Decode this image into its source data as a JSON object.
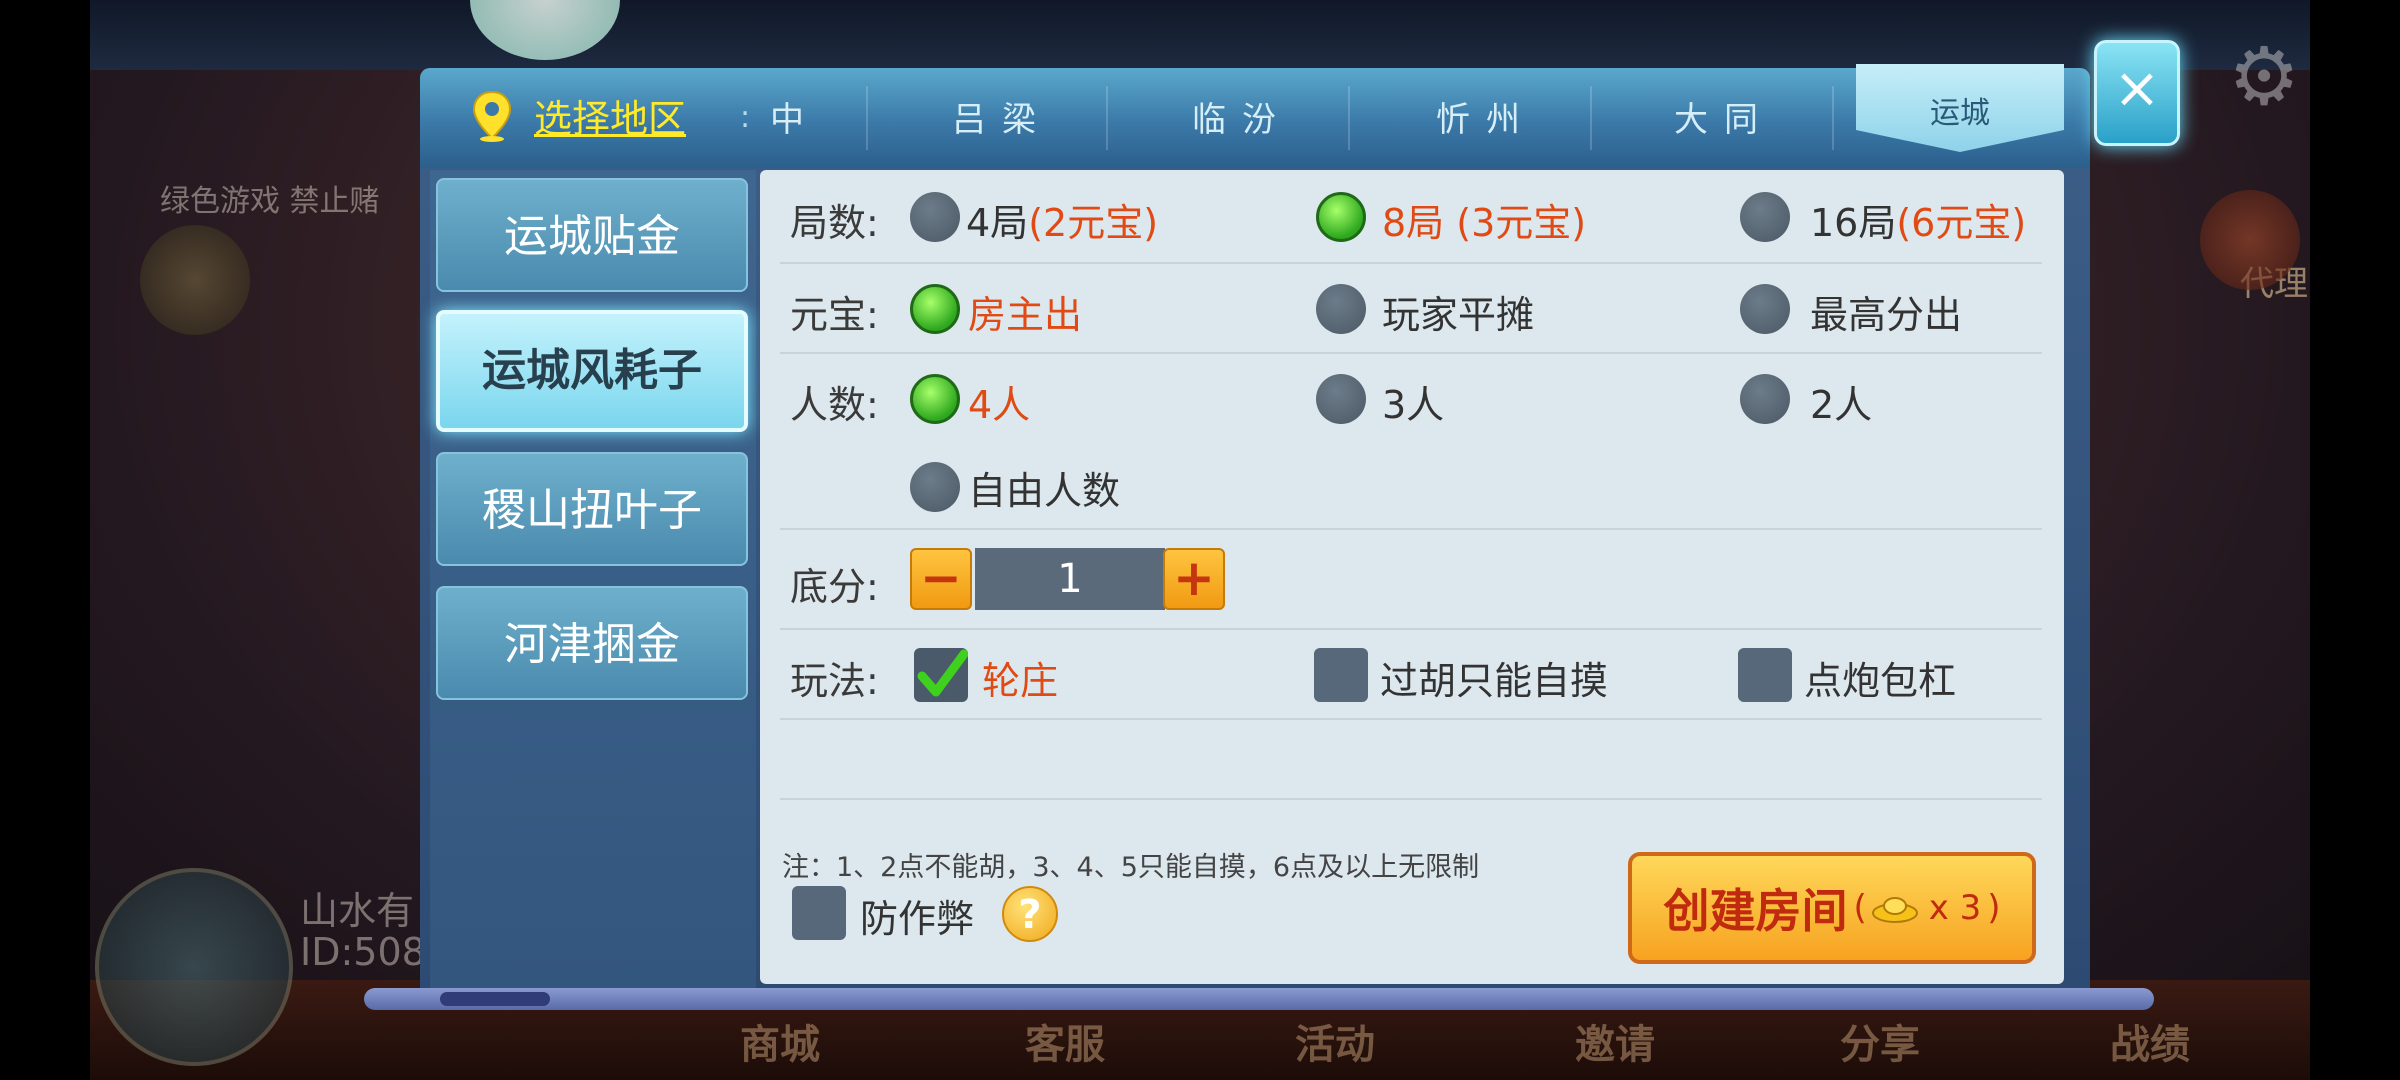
{
  "background": {
    "notice": "绿色游戏 禁止赌",
    "player_name": "山水有",
    "player_id": "ID:508",
    "agent_label": "代理",
    "bottom_tabs": [
      "商城",
      "客服",
      "活动",
      "邀请",
      "分享",
      "战绩"
    ]
  },
  "region": {
    "select_label": "选择地区",
    "separator": ":",
    "cities": [
      "中",
      "吕梁",
      "临汾",
      "忻州",
      "大同"
    ],
    "selected_city": "运城"
  },
  "categories": [
    {
      "label": "运城贴金",
      "active": false
    },
    {
      "label": "运城风耗子",
      "active": true
    },
    {
      "label": "稷山扭叶子",
      "active": false
    },
    {
      "label": "河津捆金",
      "active": false
    }
  ],
  "rounds": {
    "label": "局数:",
    "options": [
      {
        "main": "4局",
        "extra": "(2元宝)",
        "selected": false
      },
      {
        "main": "8局",
        "extra": "(3元宝)",
        "selected": true
      },
      {
        "main": "16局",
        "extra": "(6元宝)",
        "selected": false
      }
    ]
  },
  "ingot_pay": {
    "label": "元宝:",
    "options": [
      {
        "text": "房主出",
        "selected": true
      },
      {
        "text": "玩家平摊",
        "selected": false
      },
      {
        "text": "最高分出",
        "selected": false
      }
    ]
  },
  "players": {
    "label": "人数:",
    "options": [
      {
        "text": "4人",
        "selected": true
      },
      {
        "text": "3人",
        "selected": false
      },
      {
        "text": "2人",
        "selected": false
      },
      {
        "text": "自由人数",
        "selected": false
      }
    ]
  },
  "base_score": {
    "label": "底分:",
    "minus": "−",
    "plus": "+",
    "value": "1"
  },
  "rules": {
    "label": "玩法:",
    "options": [
      {
        "text": "轮庄",
        "checked": true
      },
      {
        "text": "过胡只能自摸",
        "checked": false
      },
      {
        "text": "点炮包杠",
        "checked": false
      }
    ]
  },
  "note": "注：1、2点不能胡，3、4、5只能自摸，6点及以上无限制",
  "anti_cheat": {
    "label": "防作弊",
    "checked": false,
    "help": "?"
  },
  "create": {
    "label": "创建房间",
    "open": "(",
    "cost": "x 3",
    "close": ")"
  },
  "close_icon": "×",
  "colors": {
    "accent_red": "#e04a14",
    "highlight_yellow": "#ffea2a",
    "radio_on": "#2ea81e"
  }
}
